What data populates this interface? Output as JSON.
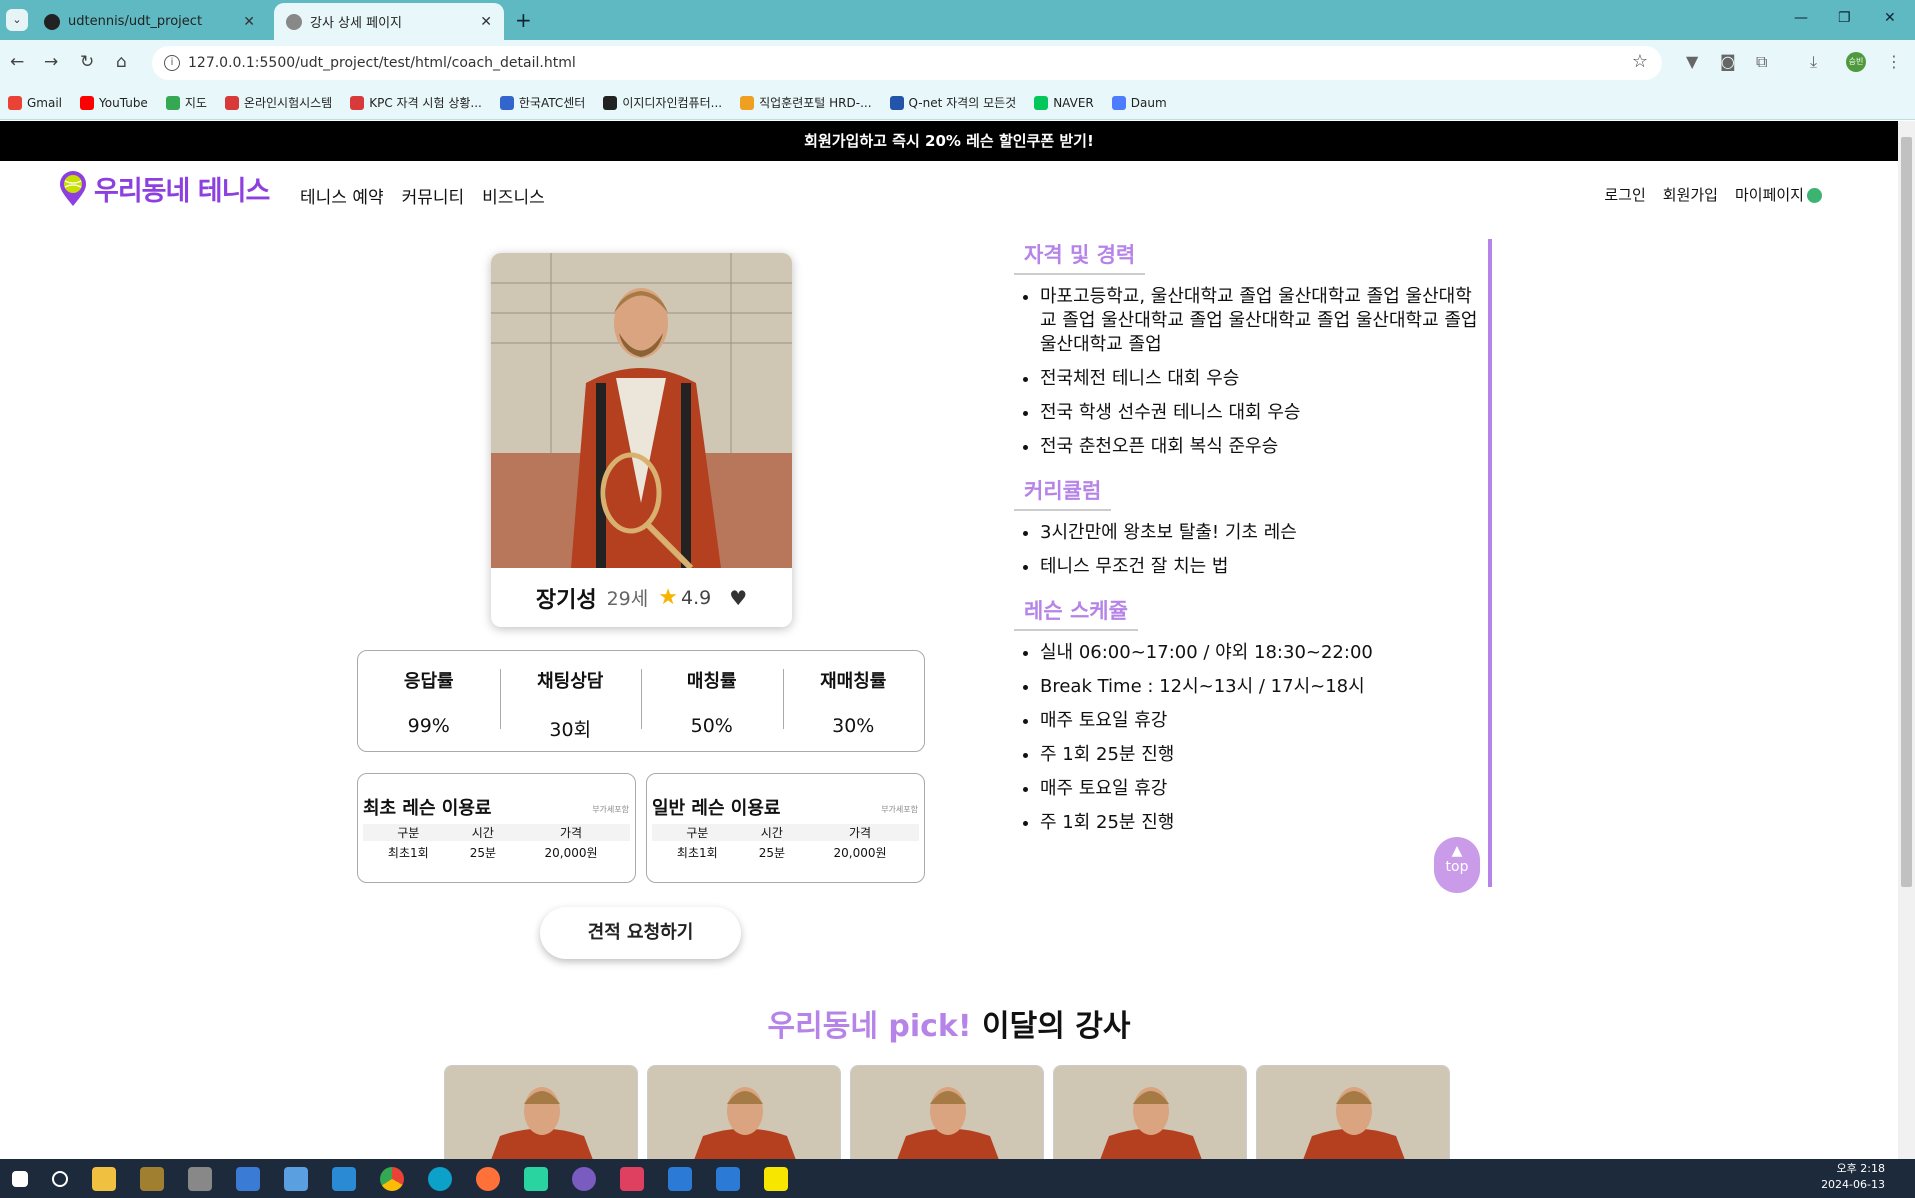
{
  "browser": {
    "tabs": [
      {
        "title": "udtennis/udt_project",
        "active": false
      },
      {
        "title": "강사 상세 페이지",
        "active": true
      }
    ],
    "url": "127.0.0.1:5500/udt_project/test/html/coach_detail.html",
    "profile_initials": "승빈",
    "bookmarks": [
      {
        "label": "Gmail",
        "color": "#ea4335"
      },
      {
        "label": "YouTube",
        "color": "#ff0000"
      },
      {
        "label": "지도",
        "color": "#34a853"
      },
      {
        "label": "온라인시험시스템",
        "color": "#d83a3a"
      },
      {
        "label": "KPC 자격 시험 상황...",
        "color": "#d83a3a"
      },
      {
        "label": "한국ATC센터",
        "color": "#3366cc"
      },
      {
        "label": "이지디자인컴퓨터...",
        "color": "#222222"
      },
      {
        "label": "직업훈련포털 HRD-...",
        "color": "#f0a020"
      },
      {
        "label": "Q-net 자격의 모든것",
        "color": "#2255aa"
      },
      {
        "label": "NAVER",
        "color": "#03c75a"
      },
      {
        "label": "Daum",
        "color": "#4d7cff"
      }
    ]
  },
  "promo": {
    "text": "회원가입하고 즉시 20% 레슨 할인쿠폰 받기!"
  },
  "nav": {
    "logo": "우리동네 테니스",
    "menu": [
      "테니스 예약",
      "커뮤니티",
      "비즈니스"
    ],
    "right": [
      "로그인",
      "회원가입",
      "마이페이지"
    ]
  },
  "coach": {
    "name": "장기성",
    "age": "29세",
    "rating": "4.9"
  },
  "stats": [
    {
      "label": "응답률",
      "value": "99%"
    },
    {
      "label": "채팅상담",
      "value": "30회"
    },
    {
      "label": "매칭률",
      "value": "50%"
    },
    {
      "label": "재매칭률",
      "value": "30%"
    }
  ],
  "fees": [
    {
      "title": "최초 레슨 이용료",
      "vat": "부가세포함",
      "headers": [
        "구분",
        "시간",
        "가격"
      ],
      "row": [
        "최초1회",
        "25분",
        "20,000원"
      ]
    },
    {
      "title": "일반 레슨 이용료",
      "vat": "부가세포함",
      "headers": [
        "구분",
        "시간",
        "가격"
      ],
      "row": [
        "최초1회",
        "25분",
        "20,000원"
      ]
    }
  ],
  "quote_button": "견적 요청하기",
  "sections": [
    {
      "title": "자격 및 경력",
      "items": [
        "마포고등학교, 울산대학교 졸업 울산대학교 졸업 울산대학교 졸업 울산대학교 졸업 울산대학교 졸업 울산대학교 졸업 울산대학교 졸업",
        "전국체전 테니스 대회 우승",
        "전국 학생 선수권 테니스 대회 우승",
        "전국 춘천오픈 대회 복식 준우승"
      ]
    },
    {
      "title": "커리큘럼",
      "items": [
        "3시간만에 왕초보 탈출! 기초 레슨",
        "테니스 무조건 잘 치는 법"
      ]
    },
    {
      "title": "레슨 스케쥴",
      "items": [
        "실내 06:00~17:00 / 야외 18:30~22:00",
        "Break Time : 12시~13시 / 17시~18시",
        "매주 토요일 휴강",
        "주 1회 25분 진행",
        "매주 토요일 휴강",
        "주 1회 25분 진행"
      ]
    }
  ],
  "top_button": "top",
  "pick": {
    "highlight": "우리동네 pick!",
    "rest": " 이달의 강사"
  },
  "taskbar": {
    "time": "오후 2:18",
    "date": "2024-06-13"
  },
  "colors": {
    "accent": "#b684e8",
    "logo": "#8e3fe0",
    "browser": "#5fb9c2"
  }
}
